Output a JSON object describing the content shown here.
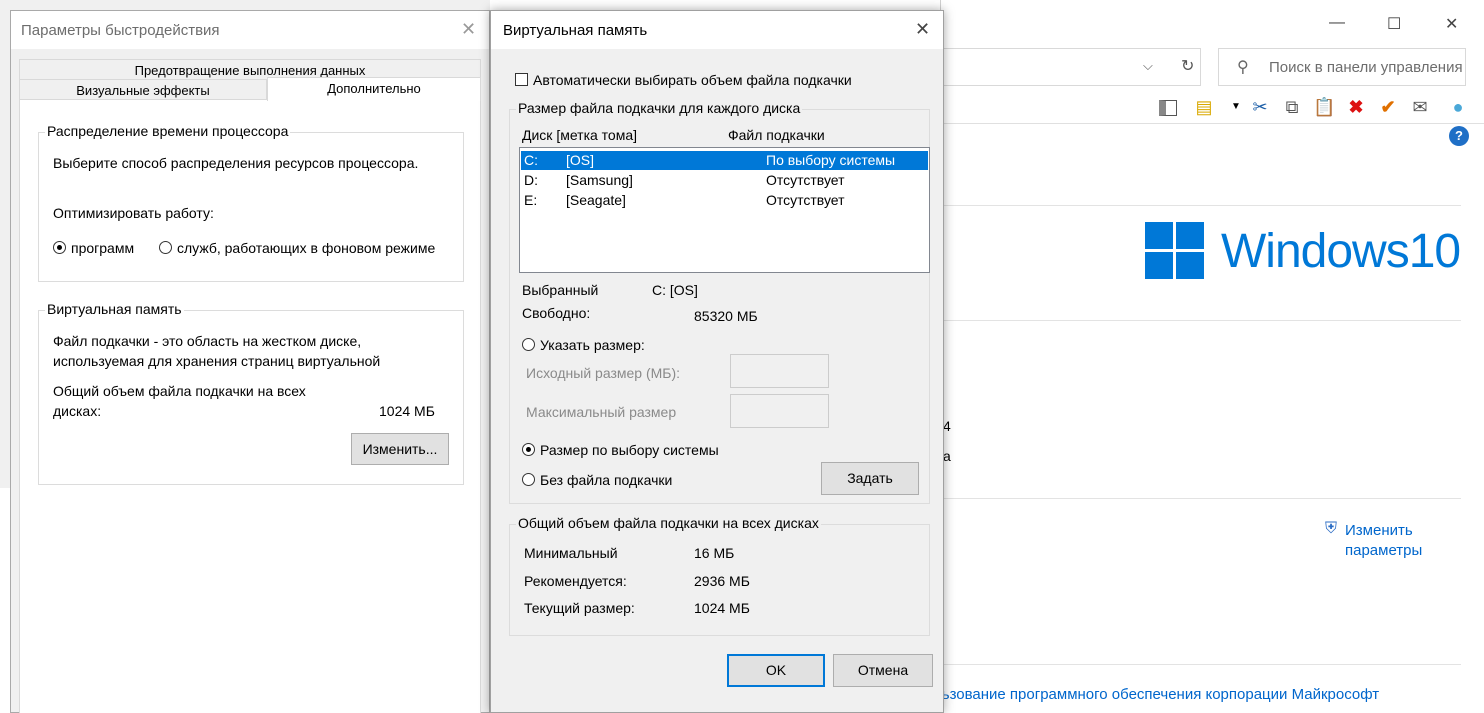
{
  "control_panel": {
    "search_placeholder": "Поиск в панели управления",
    "windows_brand": "Windows10",
    "change_settings_link_line1": "Изменить",
    "change_settings_link_line2": "параметры",
    "license_link": "льзование программного обеспечения корпорации Майкрософт",
    "partial_text_1": "4",
    "partial_text_2": "а"
  },
  "performance_options": {
    "title": "Параметры быстродействия",
    "tabs": {
      "dep": "Предотвращение выполнения данных",
      "visual": "Визуальные эффекты",
      "advanced": "Дополнительно"
    },
    "cpu_group": {
      "title": "Распределение времени процессора",
      "description": "Выберите способ распределения ресурсов процессора.",
      "optimize_label": "Оптимизировать работу:",
      "option_programs": "программ",
      "option_services": "служб, работающих в фоновом режиме",
      "selected": "программ"
    },
    "vm_group": {
      "title": "Виртуальная память",
      "description_line1": "Файл подкачки - это область на жестком диске,",
      "description_line2": "используемая для хранения страниц виртуальной",
      "total_line1": "Общий объем файла подкачки на всех",
      "total_line2": "дисках:",
      "total_value": "1024 МБ",
      "change_button": "Изменить..."
    }
  },
  "virtual_memory": {
    "title": "Виртуальная память",
    "auto_manage_label": "Автоматически выбирать объем файла подкачки",
    "auto_manage_checked": false,
    "per_drive_group": {
      "title": "Размер файла подкачки для каждого диска",
      "col_drive": "Диск [метка тома]",
      "col_pagefile": "Файл подкачки",
      "drives": [
        {
          "letter": "C:",
          "label": "[OS]",
          "pagefile": "По выбору системы",
          "selected": true
        },
        {
          "letter": "D:",
          "label": "[Samsung]",
          "pagefile": "Отсутствует",
          "selected": false
        },
        {
          "letter": "E:",
          "label": "[Seagate]",
          "pagefile": "Отсутствует",
          "selected": false
        }
      ],
      "selected_label": "Выбранный",
      "selected_value": "C:  [OS]",
      "free_label": "Свободно:",
      "free_value": "85320 МБ",
      "custom_size_label": "Указать размер:",
      "initial_size_label": "Исходный размер (МБ):",
      "initial_size_value": "",
      "max_size_label": "Максимальный размер",
      "max_size_value": "",
      "system_managed_label": "Размер по выбору системы",
      "no_pagefile_label": "Без файла подкачки",
      "selected_option": "Размер по выбору системы",
      "set_button": "Задать"
    },
    "total_group": {
      "title": "Общий объем файла подкачки на всех дисках",
      "min_label": "Минимальный",
      "min_value": "16 МБ",
      "recommended_label": "Рекомендуется:",
      "recommended_value": "2936 МБ",
      "current_label": "Текущий размер:",
      "current_value": "1024 МБ"
    },
    "ok_button": "OK",
    "cancel_button": "Отмена"
  }
}
